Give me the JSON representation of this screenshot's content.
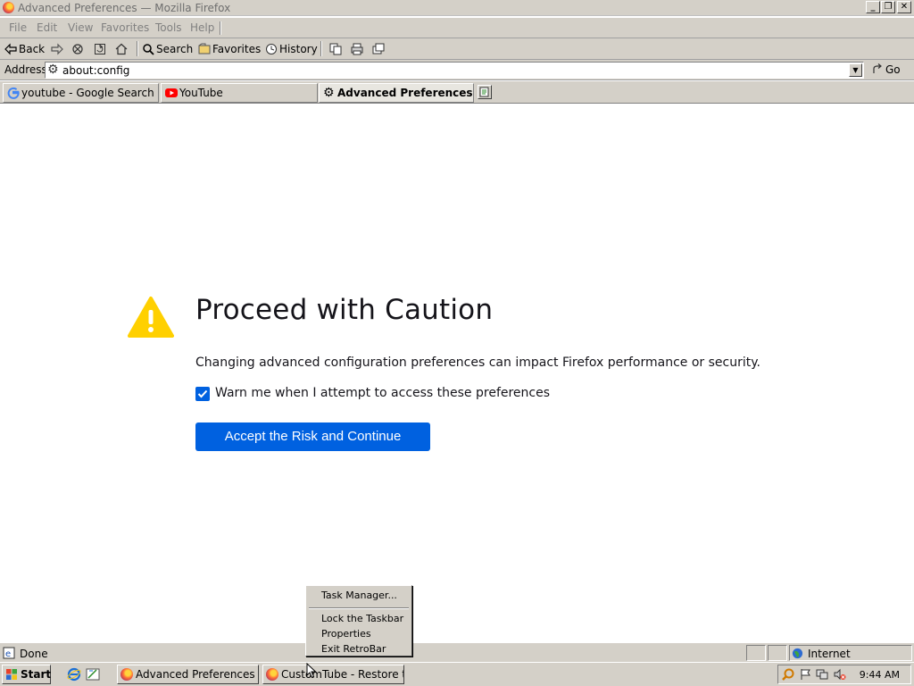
{
  "window": {
    "title": "Advanced Preferences — Mozilla Firefox",
    "minimize": "_",
    "maximize": "❐",
    "close": "✕"
  },
  "menu": [
    "File",
    "Edit",
    "View",
    "Favorites",
    "Tools",
    "Help"
  ],
  "toolbar": {
    "back": "Back",
    "search": "Search",
    "favorites": "Favorites",
    "history": "History"
  },
  "address": {
    "label": "Address",
    "value": "about:config",
    "go": "Go"
  },
  "tabs": [
    {
      "label": "youtube - Google Search",
      "icon": "google-icon"
    },
    {
      "label": "YouTube",
      "icon": "youtube-icon"
    },
    {
      "label": "Advanced Preferences",
      "icon": "gear-icon",
      "active": true
    }
  ],
  "page": {
    "heading": "Proceed with Caution",
    "description": "Changing advanced configuration preferences can impact Firefox performance or security.",
    "checkbox_label": "Warn me when I attempt to access these preferences",
    "checkbox_checked": true,
    "button": "Accept the Risk and Continue",
    "accent": "#0061e0",
    "warning_color": "#ffd000"
  },
  "status": {
    "text": "Done",
    "zone": "Internet"
  },
  "taskbar": {
    "start": "Start",
    "tasks": [
      {
        "label": "Advanced Preferences — ..."
      },
      {
        "label": "CustomTube - Restore th..."
      }
    ],
    "clock": "9:44 AM"
  },
  "context_menu": {
    "items": [
      "Task Manager...",
      "Lock the Taskbar",
      "Properties",
      "Exit RetroBar"
    ]
  }
}
